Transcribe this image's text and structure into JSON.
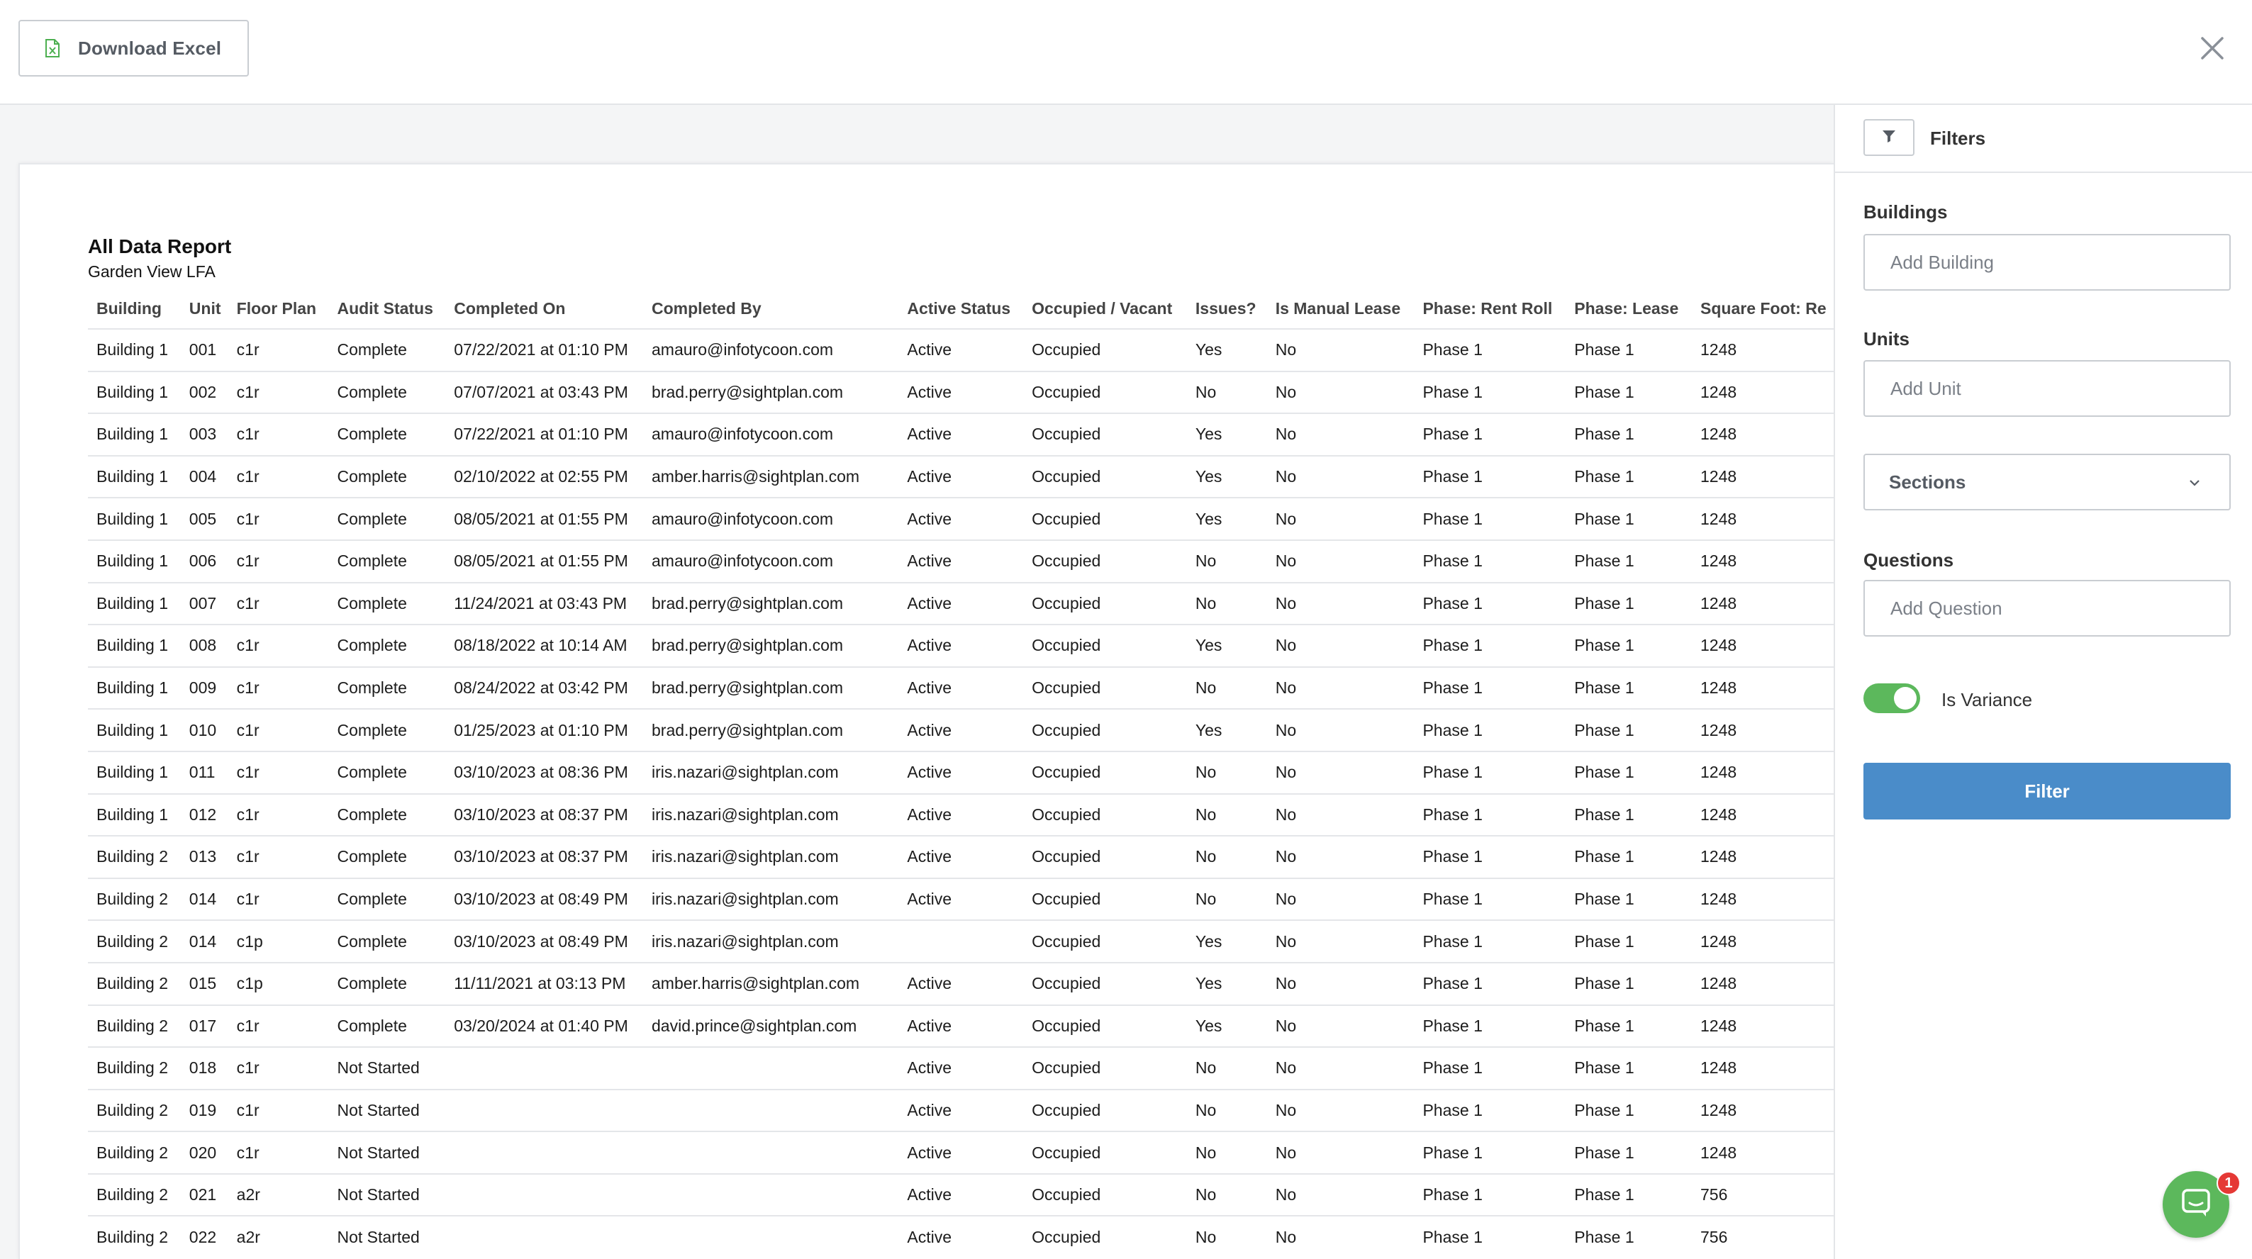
{
  "toolbar": {
    "download_label": "Download Excel",
    "download_icon": "excel-file-icon",
    "close_icon": "close-icon"
  },
  "report": {
    "title": "All Data Report",
    "subtitle": "Garden View LFA",
    "columns": [
      "Building",
      "Unit",
      "Floor Plan",
      "Audit Status",
      "Completed On",
      "Completed By",
      "Active Status",
      "Occupied / Vacant",
      "Issues?",
      "Is Manual Lease",
      "Phase: Rent Roll",
      "Phase: Lease",
      "Square Foot: Re"
    ],
    "rows": [
      [
        "Building 1",
        "001",
        "c1r",
        "Complete",
        "07/22/2021 at 01:10 PM",
        "amauro@infotycoon.com",
        "Active",
        "Occupied",
        "Yes",
        "No",
        "Phase 1",
        "Phase 1",
        "1248"
      ],
      [
        "Building 1",
        "002",
        "c1r",
        "Complete",
        "07/07/2021 at 03:43 PM",
        "brad.perry@sightplan.com",
        "Active",
        "Occupied",
        "No",
        "No",
        "Phase 1",
        "Phase 1",
        "1248"
      ],
      [
        "Building 1",
        "003",
        "c1r",
        "Complete",
        "07/22/2021 at 01:10 PM",
        "amauro@infotycoon.com",
        "Active",
        "Occupied",
        "Yes",
        "No",
        "Phase 1",
        "Phase 1",
        "1248"
      ],
      [
        "Building 1",
        "004",
        "c1r",
        "Complete",
        "02/10/2022 at 02:55 PM",
        "amber.harris@sightplan.com",
        "Active",
        "Occupied",
        "Yes",
        "No",
        "Phase 1",
        "Phase 1",
        "1248"
      ],
      [
        "Building 1",
        "005",
        "c1r",
        "Complete",
        "08/05/2021 at 01:55 PM",
        "amauro@infotycoon.com",
        "Active",
        "Occupied",
        "Yes",
        "No",
        "Phase 1",
        "Phase 1",
        "1248"
      ],
      [
        "Building 1",
        "006",
        "c1r",
        "Complete",
        "08/05/2021 at 01:55 PM",
        "amauro@infotycoon.com",
        "Active",
        "Occupied",
        "No",
        "No",
        "Phase 1",
        "Phase 1",
        "1248"
      ],
      [
        "Building 1",
        "007",
        "c1r",
        "Complete",
        "11/24/2021 at 03:43 PM",
        "brad.perry@sightplan.com",
        "Active",
        "Occupied",
        "No",
        "No",
        "Phase 1",
        "Phase 1",
        "1248"
      ],
      [
        "Building 1",
        "008",
        "c1r",
        "Complete",
        "08/18/2022 at 10:14 AM",
        "brad.perry@sightplan.com",
        "Active",
        "Occupied",
        "Yes",
        "No",
        "Phase 1",
        "Phase 1",
        "1248"
      ],
      [
        "Building 1",
        "009",
        "c1r",
        "Complete",
        "08/24/2022 at 03:42 PM",
        "brad.perry@sightplan.com",
        "Active",
        "Occupied",
        "No",
        "No",
        "Phase 1",
        "Phase 1",
        "1248"
      ],
      [
        "Building 1",
        "010",
        "c1r",
        "Complete",
        "01/25/2023 at 01:10 PM",
        "brad.perry@sightplan.com",
        "Active",
        "Occupied",
        "Yes",
        "No",
        "Phase 1",
        "Phase 1",
        "1248"
      ],
      [
        "Building 1",
        "011",
        "c1r",
        "Complete",
        "03/10/2023 at 08:36 PM",
        "iris.nazari@sightplan.com",
        "Active",
        "Occupied",
        "No",
        "No",
        "Phase 1",
        "Phase 1",
        "1248"
      ],
      [
        "Building 1",
        "012",
        "c1r",
        "Complete",
        "03/10/2023 at 08:37 PM",
        "iris.nazari@sightplan.com",
        "Active",
        "Occupied",
        "No",
        "No",
        "Phase 1",
        "Phase 1",
        "1248"
      ],
      [
        "Building 2",
        "013",
        "c1r",
        "Complete",
        "03/10/2023 at 08:37 PM",
        "iris.nazari@sightplan.com",
        "Active",
        "Occupied",
        "No",
        "No",
        "Phase 1",
        "Phase 1",
        "1248"
      ],
      [
        "Building 2",
        "014",
        "c1r",
        "Complete",
        "03/10/2023 at 08:49 PM",
        "iris.nazari@sightplan.com",
        "Active",
        "Occupied",
        "No",
        "No",
        "Phase 1",
        "Phase 1",
        "1248"
      ],
      [
        "Building 2",
        "014",
        "c1p",
        "Complete",
        "03/10/2023 at 08:49 PM",
        "iris.nazari@sightplan.com",
        "",
        "Occupied",
        "Yes",
        "No",
        "Phase 1",
        "Phase 1",
        "1248"
      ],
      [
        "Building 2",
        "015",
        "c1p",
        "Complete",
        "11/11/2021 at 03:13 PM",
        "amber.harris@sightplan.com",
        "Active",
        "Occupied",
        "Yes",
        "No",
        "Phase 1",
        "Phase 1",
        "1248"
      ],
      [
        "Building 2",
        "017",
        "c1r",
        "Complete",
        "03/20/2024 at 01:40 PM",
        "david.prince@sightplan.com",
        "Active",
        "Occupied",
        "Yes",
        "No",
        "Phase 1",
        "Phase 1",
        "1248"
      ],
      [
        "Building 2",
        "018",
        "c1r",
        "Not Started",
        "",
        "",
        "Active",
        "Occupied",
        "No",
        "No",
        "Phase 1",
        "Phase 1",
        "1248"
      ],
      [
        "Building 2",
        "019",
        "c1r",
        "Not Started",
        "",
        "",
        "Active",
        "Occupied",
        "No",
        "No",
        "Phase 1",
        "Phase 1",
        "1248"
      ],
      [
        "Building 2",
        "020",
        "c1r",
        "Not Started",
        "",
        "",
        "Active",
        "Occupied",
        "No",
        "No",
        "Phase 1",
        "Phase 1",
        "1248"
      ],
      [
        "Building 2",
        "021",
        "a2r",
        "Not Started",
        "",
        "",
        "Active",
        "Occupied",
        "No",
        "No",
        "Phase 1",
        "Phase 1",
        "756"
      ],
      [
        "Building 2",
        "022",
        "a2r",
        "Not Started",
        "",
        "",
        "Active",
        "Occupied",
        "No",
        "No",
        "Phase 1",
        "Phase 1",
        "756"
      ]
    ]
  },
  "filters": {
    "title": "Filters",
    "icon": "funnel-icon",
    "buildings_label": "Buildings",
    "buildings_placeholder": "Add Building",
    "units_label": "Units",
    "units_placeholder": "Add Unit",
    "sections_label": "Sections",
    "questions_label": "Questions",
    "questions_placeholder": "Add Question",
    "variance_label": "Is Variance",
    "variance_on": true,
    "filter_button": "Filter"
  },
  "chat": {
    "badge_count": "1",
    "icon": "chat-icon"
  },
  "colors": {
    "accent_green": "#5cb85c",
    "filter_button_blue": "#4a8cc9",
    "badge_red": "#e53935"
  }
}
